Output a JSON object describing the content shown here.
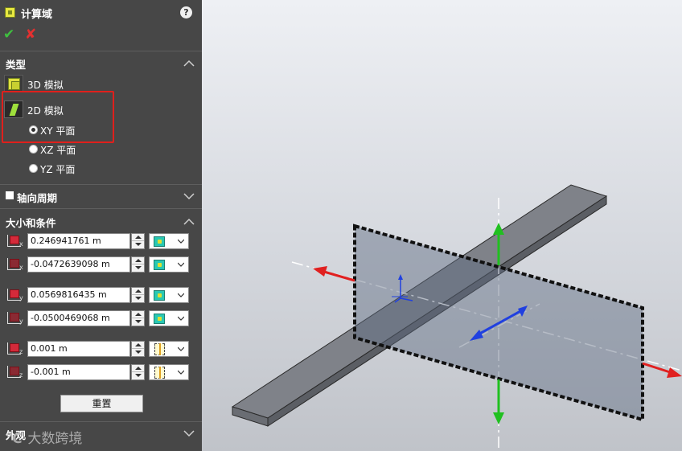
{
  "panel": {
    "title": "计算域",
    "help_glyph": "?",
    "ok_glyph": "✔",
    "cancel_glyph": "✘"
  },
  "type_section": {
    "title": "类型",
    "options": [
      {
        "label": "3D 模拟",
        "selected": false
      },
      {
        "label": "2D 模拟",
        "selected": true
      }
    ],
    "planes": [
      {
        "label": "XY 平面",
        "selected": true
      },
      {
        "label": "XZ 平面",
        "selected": false
      },
      {
        "label": "YZ 平面",
        "selected": false
      }
    ]
  },
  "axial_section": {
    "title": "轴向周期",
    "checked": false
  },
  "size_section": {
    "title": "大小和条件",
    "params": [
      {
        "axis": "x",
        "value": "0.246941761 m",
        "condition": "pressure-opening-icon"
      },
      {
        "axis": "x",
        "value": "-0.0472639098 m",
        "condition": "pressure-opening-icon"
      },
      {
        "axis": "y",
        "value": "0.0569816435 m",
        "condition": "pressure-opening-icon"
      },
      {
        "axis": "y",
        "value": "-0.0500469068 m",
        "condition": "pressure-opening-icon"
      },
      {
        "axis": "z",
        "value": "0.001 m",
        "condition": "symmetry-icon"
      },
      {
        "axis": "z",
        "value": "-0.001 m",
        "condition": "symmetry-icon"
      }
    ],
    "reset_label": "重置"
  },
  "appearance_section": {
    "title": "外观"
  },
  "watermark": {
    "logo": "℃",
    "text": "大数跨境"
  },
  "colors": {
    "panel_bg": "#474747",
    "highlight": "#e0201c",
    "accent_green": "#3fbf3f",
    "accent_red": "#e33030",
    "axis_x": "#e02020",
    "axis_y": "#20c020",
    "axis_z": "#2040e0"
  }
}
